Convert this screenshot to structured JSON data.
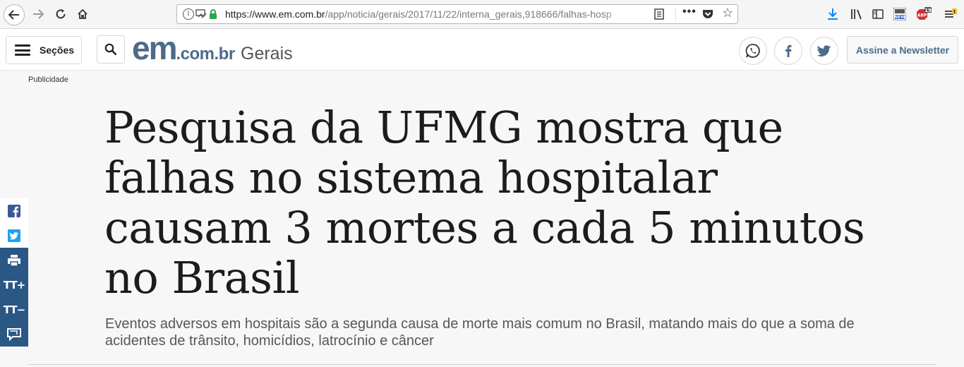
{
  "browser": {
    "url_host": "https://www.em.com.br",
    "url_path": "/app/noticia/gerais/2017/11/22/interna_gerais,918666/falhas-hosp",
    "abp_count": "19"
  },
  "header": {
    "sections_label": "Seções",
    "logo_em": "em",
    "logo_domain": ".com.br",
    "section_name": "Gerais",
    "newsletter_label": "Assine a Newsletter"
  },
  "ad": {
    "label": "Publicidade"
  },
  "article": {
    "headline": "Pesquisa da UFMG mostra que falhas no sistema hospitalar causam 3 mortes a cada 5 minutos no Brasil",
    "subheadline": "Eventos adversos em hospitais são a segunda causa de morte mais comum no Brasil, matando mais do que a soma de acidentes de trânsito, homicídios, latrocínio e câncer"
  },
  "colors": {
    "brand": "#4d6b8a",
    "side_bar_dark": "#2a5784",
    "facebook": "#3b5998",
    "twitter": "#1da1f2",
    "download": "#0a84ff"
  },
  "icons": {
    "browser": [
      "back-arrow-icon",
      "forward-arrow-icon",
      "reload-icon",
      "home-icon",
      "info-icon",
      "permissions-icon",
      "lock-icon",
      "reader-view-icon",
      "page-actions-icon",
      "pocket-icon",
      "bookmark-star-icon",
      "download-icon",
      "library-icon",
      "sidebar-icon",
      "news-icon",
      "adblock-icon",
      "hamburger-menu-icon"
    ],
    "site": [
      "menu-icon",
      "search-icon",
      "whatsapp-icon",
      "facebook-icon",
      "twitter-icon"
    ],
    "side_bar": [
      "facebook-icon",
      "twitter-icon",
      "print-icon",
      "font-increase-icon",
      "font-decrease-icon",
      "comments-icon"
    ]
  },
  "side_bar": {
    "font_increase": "TT+",
    "font_decrease": "TT−"
  }
}
